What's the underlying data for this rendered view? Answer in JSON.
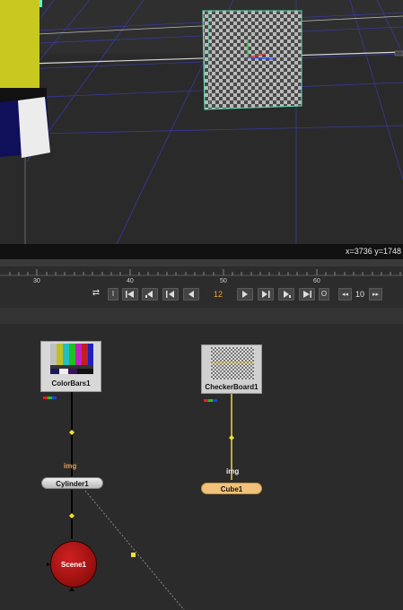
{
  "viewer": {
    "coordinates": "x=3736 y=1748"
  },
  "timeline": {
    "ticks": [
      "30",
      "40",
      "50",
      "60"
    ],
    "current_frame": "12",
    "step_value": "10",
    "in_label": "I",
    "out_label": "O"
  },
  "nodes": {
    "colorbars": "ColorBars1",
    "checkerboard": "CheckerBoard1",
    "cylinder": "Cylinder1",
    "cube": "Cube1",
    "scene": "Scene1",
    "cylinder_input": "img",
    "cube_input": "img"
  },
  "colors": {
    "accent": "#f0a030",
    "selected_node": "#f2c27a",
    "scene_node": "#b01010",
    "connection_active": "#f0d23a"
  }
}
